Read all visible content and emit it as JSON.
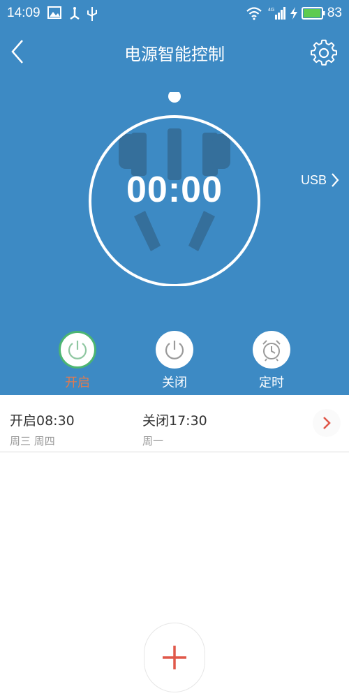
{
  "status_bar": {
    "time": "14:09",
    "battery_level": "83",
    "icons": [
      "image-icon",
      "usb-icon",
      "wifi-icon",
      "signal-icon",
      "charging-icon",
      "battery-icon"
    ]
  },
  "header": {
    "title": "电源智能控制",
    "back_icon": "back-chevron-icon",
    "settings_icon": "gear-icon"
  },
  "timer": {
    "display": "00:00"
  },
  "usb": {
    "label": "USB"
  },
  "actions": [
    {
      "label": "开启",
      "icon": "power-icon",
      "active": true
    },
    {
      "label": "关闭",
      "icon": "power-icon",
      "active": false
    },
    {
      "label": "定时",
      "icon": "alarm-clock-icon",
      "active": false
    }
  ],
  "schedule": {
    "on": {
      "label": "开启08:30",
      "days": "周三 周四"
    },
    "off": {
      "label": "关闭17:30",
      "days": "周一"
    }
  },
  "colors": {
    "primary_blue": "#3d8ac4",
    "active_green": "#4cb572",
    "accent_orange": "#e07a4f",
    "add_red": "#e0584a"
  }
}
